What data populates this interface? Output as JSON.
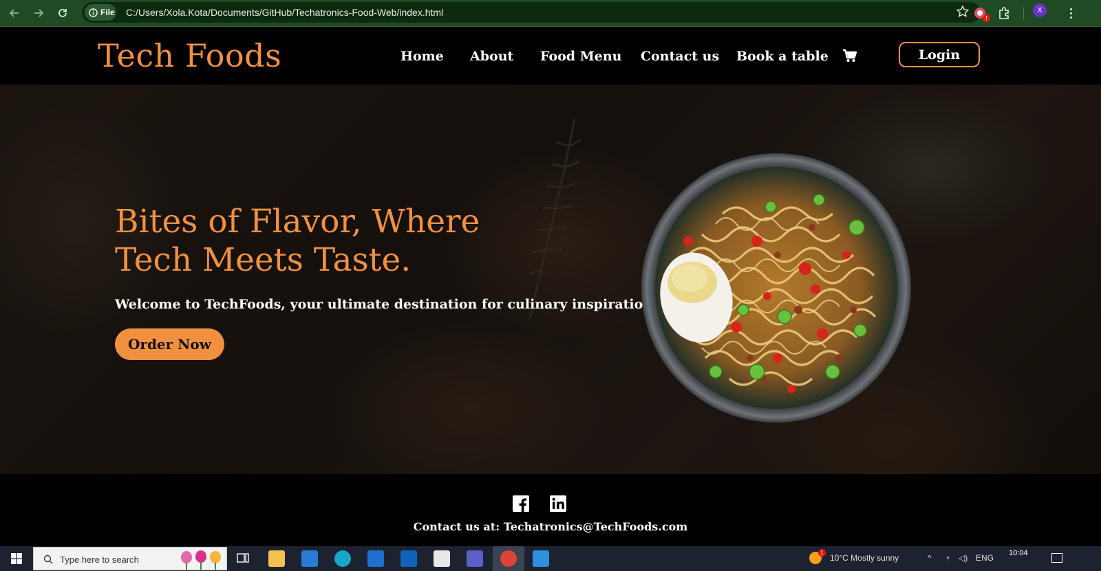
{
  "browser": {
    "file_chip": "File",
    "url": "C:/Users/Xola.Kota/Documents/GitHub/Techatronics-Food-Web/index.html",
    "profile_initial": "X",
    "ext_badge": "!"
  },
  "site": {
    "brand": "Tech Foods",
    "nav": [
      "Home",
      "About",
      "Food Menu",
      "Contact us",
      "Book a table"
    ],
    "login_label": "Login",
    "accent_color": "#f1913f"
  },
  "hero": {
    "headline_line1": "Bites of Flavor, Where",
    "headline_line2": "Tech Meets Taste.",
    "tagline": "Welcome to TechFoods, your ultimate destination for culinary inspiration!",
    "cta_label": "Order Now"
  },
  "footer": {
    "social": [
      "facebook-icon",
      "linkedin-icon"
    ],
    "contact": "Contact us at: Techatronics@TechFoods.com"
  },
  "taskbar": {
    "search_placeholder": "Type here to search",
    "weather": "10°C  Mostly sunny",
    "lang": "ENG",
    "time": "10:04",
    "notify_badge": "1"
  }
}
